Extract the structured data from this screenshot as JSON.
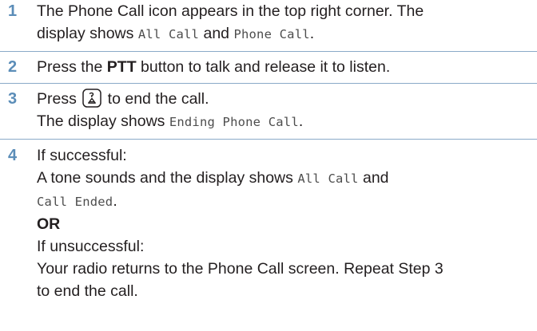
{
  "steps": [
    {
      "number": "1",
      "lines": {
        "l1": "The Phone Call icon appears in the top right corner. The",
        "l2_prefix": "display shows ",
        "l2_mono1": "All Call",
        "l2_mid": " and ",
        "l2_mono2": "Phone Call",
        "l2_suffix": "."
      }
    },
    {
      "number": "2",
      "lines": {
        "l1_prefix": "Press the ",
        "l1_bold": "PTT",
        "l1_suffix": " button to talk and release it to listen."
      }
    },
    {
      "number": "3",
      "icon": "end-call-key-icon",
      "lines": {
        "l1_prefix": "Press ",
        "l1_suffix": " to end the call.",
        "l2_prefix": "The display shows ",
        "l2_mono": "Ending Phone Call",
        "l2_suffix": "."
      }
    },
    {
      "number": "4",
      "lines": {
        "l1": "If successful:",
        "l2_prefix": "A tone sounds and the display shows ",
        "l2_mono": "All Call",
        "l2_suffix": " and",
        "l3_mono": "Call Ended",
        "l3_suffix": ".",
        "l4_bold": "OR",
        "l5": "If unsuccessful:",
        "l6": "Your radio returns to the Phone Call screen. Repeat Step 3",
        "l7": "to end the call."
      }
    }
  ],
  "colors": {
    "step_number": "#5b8db8",
    "divider": "#8aaac8",
    "body_text": "#231f20",
    "mono_text": "#4d4d4d"
  }
}
